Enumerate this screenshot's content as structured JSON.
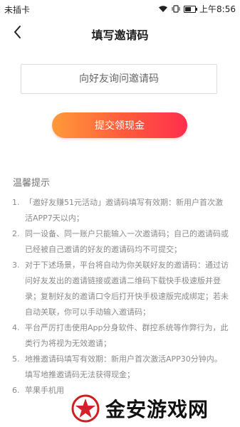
{
  "status_bar": {
    "carrier": "未插卡",
    "time": "上午8:56",
    "battery_level": 0.6
  },
  "header": {
    "title": "填写邀请码"
  },
  "invite_input": {
    "placeholder": "向好友询问邀请码",
    "value": ""
  },
  "submit_button": {
    "label": "提交领现金"
  },
  "tips": {
    "title": "温馨提示",
    "items": [
      {
        "num": "1.",
        "text": "「邀好友赚51元活动」邀请码填写有效期：新用户首次激活APP7天以内；"
      },
      {
        "num": "2.",
        "text": "同一设备、同一账户只能输入一次邀请码；自己的邀请码或已经被自己邀请的好友的邀请码均不可提交；"
      },
      {
        "num": "3.",
        "text": "对于下述场景，平台将自动为你关联好友的邀请码：通过访问好友发出的邀请链接或邀请二维码下载快手极速版并登录；复制好友的邀请口令后打开快手极速版完成绑定；若未自动关联，你可以手动输入邀请码；"
      },
      {
        "num": "4.",
        "text": "平台严厉打击使用App分身软件、群控系统等作弊行为，此类行为将视为无效邀请；"
      },
      {
        "num": "5.",
        "text": "地推邀请码填写有效期：新用户首次激活APP30分钟内。填写地推邀请码无法获得现金；"
      },
      {
        "num": "6.",
        "text": "苹果手机用"
      }
    ]
  },
  "watermark": {
    "text": "金安游戏网"
  },
  "colors": {
    "button_start": "#ff9a3a",
    "button_end": "#ff2e4e"
  }
}
